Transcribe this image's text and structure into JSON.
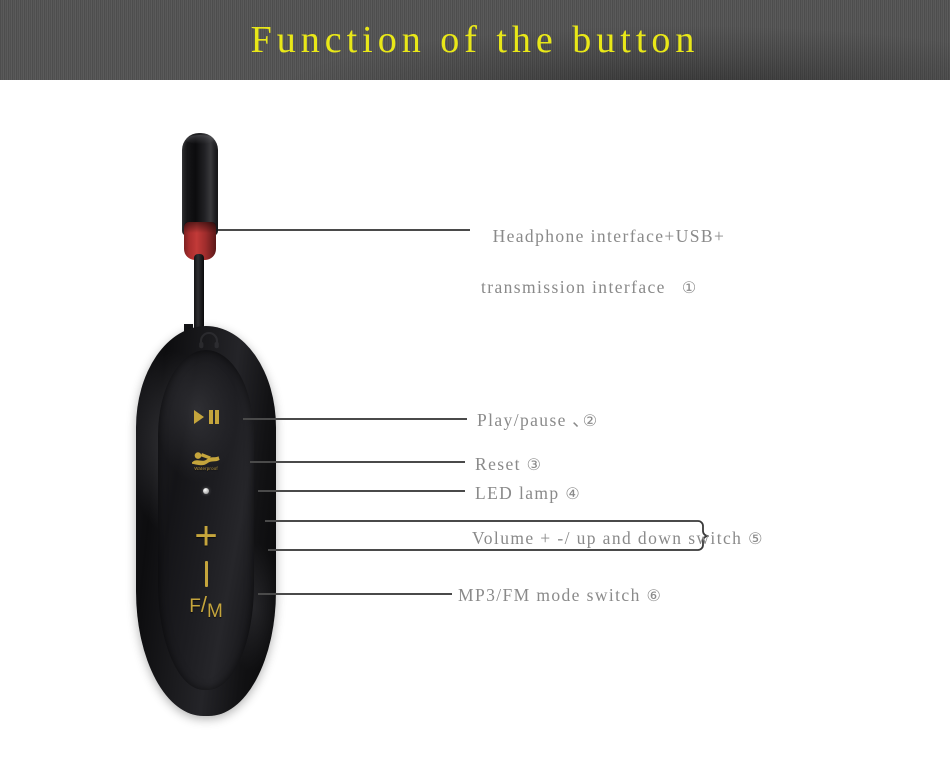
{
  "header": {
    "title": "Function of the button",
    "title_color": "#e9e818",
    "background_color": "#535353"
  },
  "device": {
    "name": "waterproof-mp3-player",
    "controls": [
      {
        "id": "headphone-port",
        "icon": "headphone-icon",
        "label": ""
      },
      {
        "id": "play-pause",
        "icon": "play-pause-icon",
        "label": ""
      },
      {
        "id": "reset",
        "icon": "waterproof-swimmer-icon",
        "label": "Waterproof"
      },
      {
        "id": "led-lamp",
        "icon": "led-dot-icon",
        "label": ""
      },
      {
        "id": "volume-up",
        "icon": "plus-icon",
        "label": "+"
      },
      {
        "id": "volume-down",
        "icon": "minus-icon",
        "label": "-"
      },
      {
        "id": "mode-switch",
        "icon": "fm-text-icon",
        "label": "F/M"
      }
    ],
    "fm_text": {
      "f": "F",
      "slash": "/",
      "m": "M"
    },
    "plus_text": "+"
  },
  "callouts": [
    {
      "number": "①",
      "text_line1": "Headphone interface+USB+",
      "text_line2": "transmission interface"
    },
    {
      "number": "②",
      "text": "Play/pause ､"
    },
    {
      "number": "③",
      "text": "Reset "
    },
    {
      "number": "④",
      "text": "LED lamp "
    },
    {
      "number": "⑤",
      "text": "Volume + -/ up and down switch "
    },
    {
      "number": "⑥",
      "text": "MP3/FM mode switch "
    }
  ],
  "colors": {
    "label_text": "#8a8a8a",
    "leader_line": "#4a4a4a",
    "gold_accent": "#c5a53c",
    "grommet_red": "#b33330"
  }
}
